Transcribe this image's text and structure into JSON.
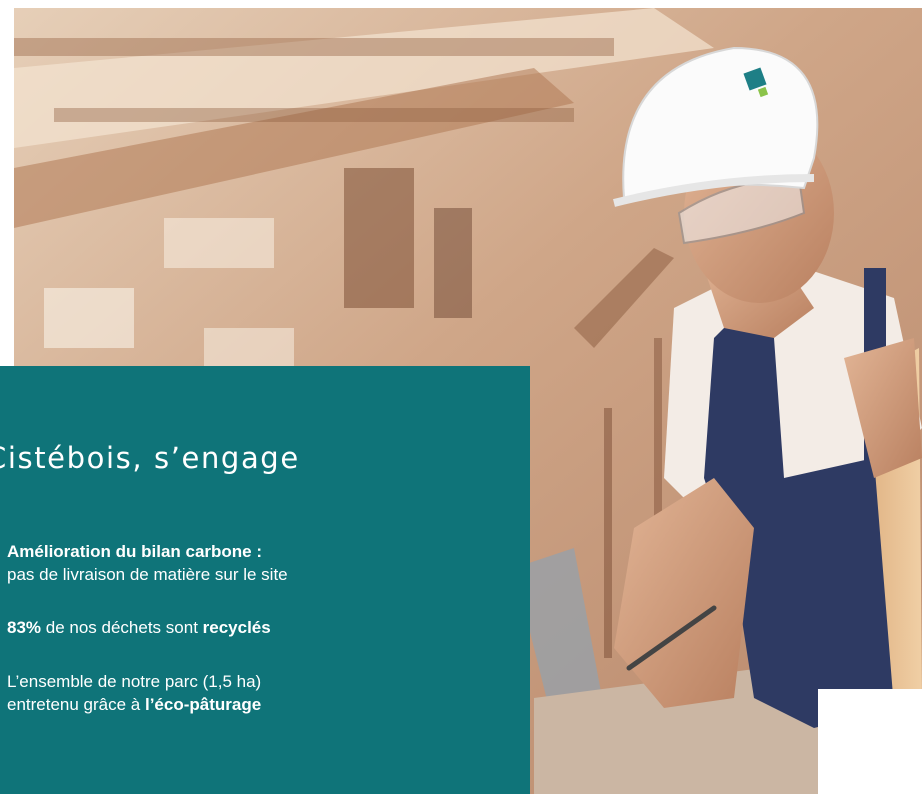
{
  "panel": {
    "title": "Cistébois, s’engage",
    "items": [
      {
        "line1_bold": "Amélioration du bilan carbone :",
        "line2": "pas de livraison de matière sur le site"
      },
      {
        "bold_a": "83%",
        "text_a": " de nos déchets sont ",
        "bold_b": "recyclés"
      },
      {
        "line1": "L’ensemble de notre parc (1,5 ha)",
        "line2_text": "entretenu grâce à ",
        "line2_bold": "l’éco-pâturage"
      }
    ]
  },
  "colors": {
    "panel_bg": "#0f7479",
    "text": "#ffffff"
  },
  "photo": {
    "subject": "worker-in-white-hard-hat-writing-in-workshop"
  }
}
